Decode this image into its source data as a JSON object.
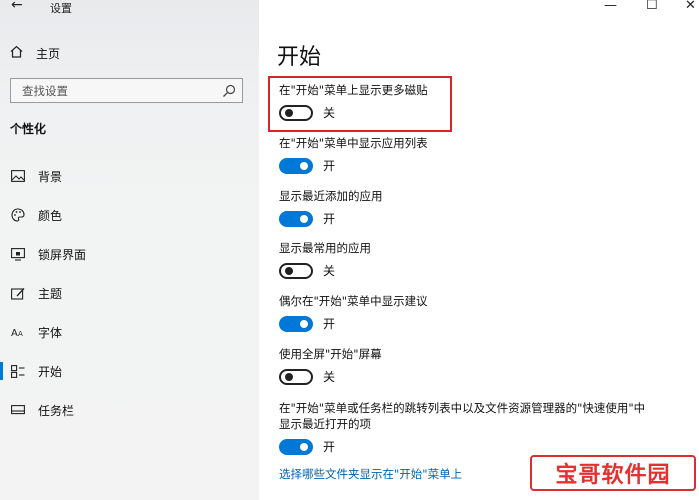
{
  "window": {
    "back_glyph": "←",
    "title": "设置",
    "controls": [
      "—",
      "☐",
      "✕"
    ]
  },
  "sidebar": {
    "home_label": "主页",
    "search_placeholder": "查找设置",
    "section_title": "个性化",
    "items": [
      {
        "label": "背景",
        "icon": "picture-icon"
      },
      {
        "label": "颜色",
        "icon": "palette-icon"
      },
      {
        "label": "锁屏界面",
        "icon": "lockscreen-icon"
      },
      {
        "label": "主题",
        "icon": "theme-icon"
      },
      {
        "label": "字体",
        "icon": "font-icon"
      },
      {
        "label": "开始",
        "icon": "start-icon",
        "active": true
      },
      {
        "label": "任务栏",
        "icon": "taskbar-icon"
      }
    ]
  },
  "main": {
    "title": "开始",
    "settings": [
      {
        "label": "在\"开始\"菜单上显示更多磁贴",
        "on": false,
        "state": "关"
      },
      {
        "label": "在\"开始\"菜单中显示应用列表",
        "on": true,
        "state": "开"
      },
      {
        "label": "显示最近添加的应用",
        "on": true,
        "state": "开"
      },
      {
        "label": "显示最常用的应用",
        "on": false,
        "state": "关"
      },
      {
        "label": "偶尔在\"开始\"菜单中显示建议",
        "on": true,
        "state": "开"
      },
      {
        "label": "使用全屏\"开始\"屏幕",
        "on": false,
        "state": "关"
      },
      {
        "label_line1": "在\"开始\"菜单或任务栏的跳转列表中以及文件资源管理器的\"快速使用\"中",
        "label_line2": "显示最近打开的项",
        "on": true,
        "state": "开"
      }
    ],
    "link": "选择哪些文件夹显示在\"开始\"菜单上"
  },
  "watermark": {
    "text": "宝哥软件园"
  },
  "colors": {
    "accent": "#0078d7",
    "highlight": "#d9262c",
    "link": "#0063b1"
  }
}
